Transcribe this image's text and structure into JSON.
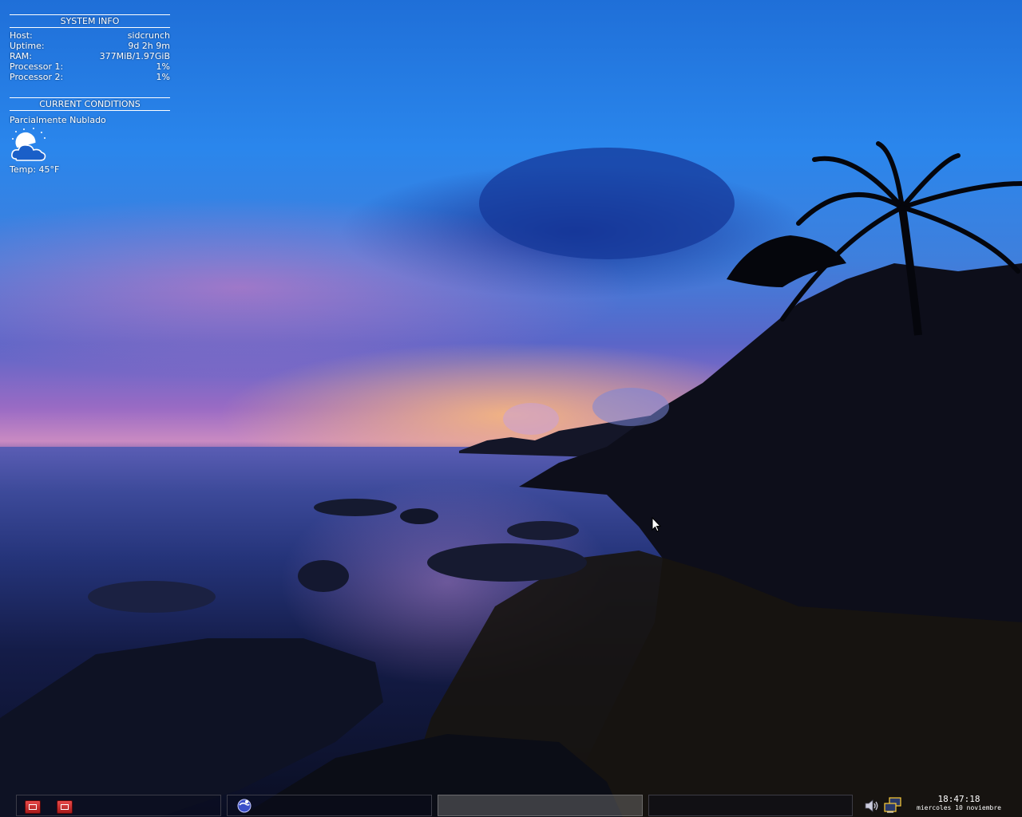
{
  "conky": {
    "system_header": "SYSTEM INFO",
    "system_rows": [
      {
        "label": "Host:",
        "value": "sidcrunch"
      },
      {
        "label": "Uptime:",
        "value": "9d 2h 9m"
      },
      {
        "label": "RAM:",
        "value": "377MiB/1.97GiB"
      },
      {
        "label": "Processor 1:",
        "value": "1%"
      },
      {
        "label": "Processor 2:",
        "value": "1%"
      }
    ],
    "conditions_header": "CURRENT CONDITIONS",
    "conditions_text": "Parcialmente Nublado",
    "weather_icon": "partly-cloudy-night-icon",
    "temperature": "Temp: 45°F"
  },
  "panel": {
    "launchers": [
      "app-launcher-icon",
      "app-launcher-icon"
    ],
    "task_icon": "globe-app-icon",
    "tray_icons": [
      "volume-icon",
      "network-icon"
    ],
    "clock_time": "18:47:18",
    "clock_date": "miercoles 10 noviembre"
  },
  "colors": {
    "sky_top": "#1f6fd8",
    "sunset_pink": "#c98ac2",
    "sea_dark": "#0a0e22"
  }
}
